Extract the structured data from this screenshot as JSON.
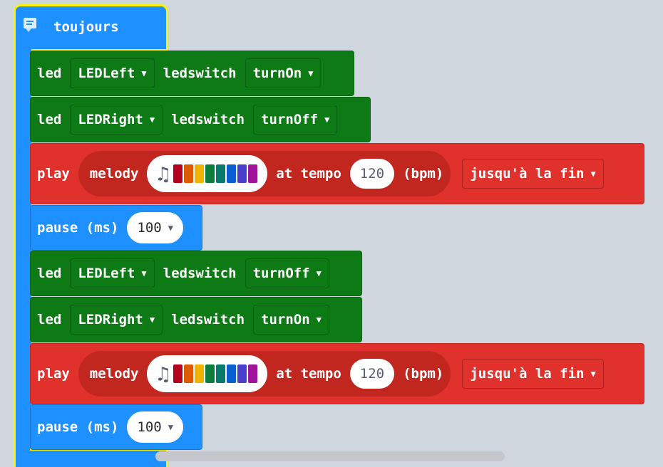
{
  "hat": {
    "label": "toujours"
  },
  "blocks": [
    {
      "type": "led",
      "led_label": "led",
      "target": "LEDLeft",
      "ledswitch_label": "ledswitch",
      "state": "turnOn"
    },
    {
      "type": "led",
      "led_label": "led",
      "target": "LEDRight",
      "ledswitch_label": "ledswitch",
      "state": "turnOff"
    },
    {
      "type": "play",
      "play_label": "play",
      "melody_label": "melody",
      "at_tempo_label": "at tempo",
      "tempo": "120",
      "bpm_label": "(bpm)",
      "mode": "jusqu'à la fin"
    },
    {
      "type": "pause",
      "pause_label": "pause (ms)",
      "value": "100"
    },
    {
      "type": "led",
      "led_label": "led",
      "target": "LEDLeft",
      "ledswitch_label": "ledswitch",
      "state": "turnOff"
    },
    {
      "type": "led",
      "led_label": "led",
      "target": "LEDRight",
      "ledswitch_label": "ledswitch",
      "state": "turnOn"
    },
    {
      "type": "play",
      "play_label": "play",
      "melody_label": "melody",
      "at_tempo_label": "at tempo",
      "tempo": "120",
      "bpm_label": "(bpm)",
      "mode": "jusqu'à la fin"
    },
    {
      "type": "pause",
      "pause_label": "pause (ms)",
      "value": "100"
    }
  ],
  "colors": {
    "led_block": "#0d7a16",
    "play_block": "#e0312c",
    "pause_block": "#1e90ff",
    "hat_block": "#1e90ff",
    "highlight": "#fff200",
    "melody_keys": [
      "#b4001e",
      "#e05a00",
      "#f2b200",
      "#0e7c3c",
      "#087a6c",
      "#0a5fd0",
      "#4a3fcc",
      "#a0149c"
    ]
  },
  "icons": {
    "hat_icon": "comment-icon",
    "melody_icon": "music-note-icon",
    "dropdown": "dropdown-triangle-icon"
  }
}
